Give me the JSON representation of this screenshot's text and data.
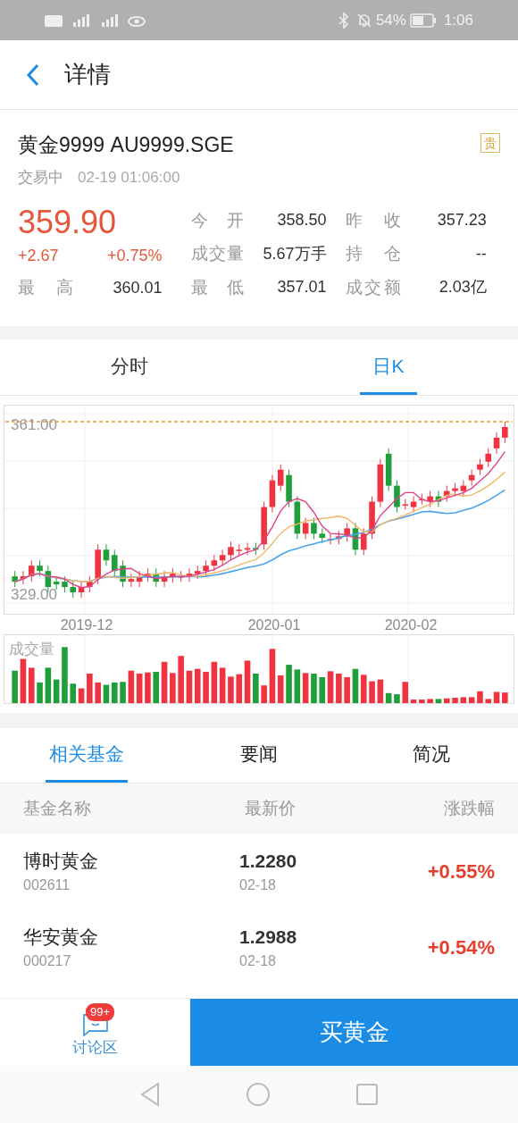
{
  "status_bar": {
    "battery": "54%",
    "time": "1:06"
  },
  "header": {
    "title": "详情"
  },
  "quote": {
    "name": "黄金9999 AU9999.SGE",
    "tag": "贵",
    "status": "交易中",
    "timestamp": "02-19 01:06:00",
    "price": "359.90",
    "change": "+2.67",
    "change_pct": "+0.75%",
    "high": {
      "label": "最 高",
      "value": "360.01"
    },
    "stats": [
      {
        "label": "今 开",
        "value": "358.50"
      },
      {
        "label": "昨 收",
        "value": "357.23"
      },
      {
        "label": "成交量",
        "value": "5.67万手"
      },
      {
        "label": "持 仓",
        "value": "--"
      },
      {
        "label": "最 低",
        "value": "357.01"
      },
      {
        "label": "成交额",
        "value": "2.03亿"
      }
    ]
  },
  "chart_tabs": [
    {
      "label": "分时",
      "selected": false
    },
    {
      "label": "日K",
      "selected": true
    }
  ],
  "chart": {
    "max_label": "361.00",
    "min_label": "329.00",
    "dates": [
      "2019-12",
      "2020-01",
      "2020-02"
    ],
    "volume_label": "成交量"
  },
  "info_tabs": [
    {
      "label": "相关基金",
      "selected": true
    },
    {
      "label": "要闻",
      "selected": false
    },
    {
      "label": "简况",
      "selected": false
    }
  ],
  "funds": {
    "columns": [
      "基金名称",
      "最新价",
      "涨跌幅"
    ],
    "rows": [
      {
        "name": "博时黄金",
        "code": "002611",
        "price": "1.2280",
        "date": "02-18",
        "change": "+0.55%"
      },
      {
        "name": "华安黄金",
        "code": "000217",
        "price": "1.2988",
        "date": "02-18",
        "change": "+0.54%"
      }
    ]
  },
  "bottom": {
    "discuss_label": "讨论区",
    "badge": "99+",
    "buy_button": "买黄金"
  }
}
